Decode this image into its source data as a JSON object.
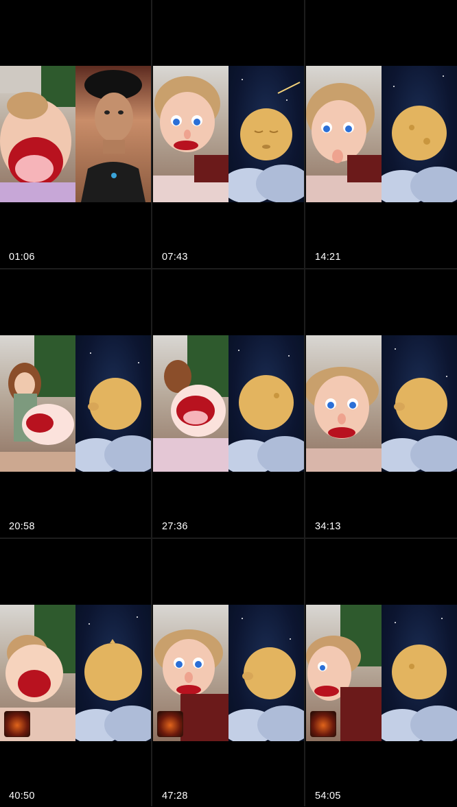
{
  "grid": {
    "cells": [
      {
        "time": "01:06",
        "left": "puppet-mouth-open",
        "right": "person-selfie"
      },
      {
        "time": "07:43",
        "left": "puppet-blue-eyes",
        "right": "moon-face-shooting-star"
      },
      {
        "time": "14:21",
        "left": "puppet-blue-eyes",
        "right": "moon"
      },
      {
        "time": "20:58",
        "left": "doll-and-puppet-hand",
        "right": "moon-face-side"
      },
      {
        "time": "27:36",
        "left": "puppet-mouth-open",
        "right": "moon"
      },
      {
        "time": "34:13",
        "left": "puppet-blue-eyes",
        "right": "moon-face-side"
      },
      {
        "time": "40:50",
        "left": "puppet-mouth-open",
        "right": "moon",
        "badge": true
      },
      {
        "time": "47:28",
        "left": "puppet-blue-eyes",
        "right": "moon-face-side",
        "badge": true
      },
      {
        "time": "54:05",
        "left": "puppet-mouth-open",
        "right": "moon",
        "badge": true
      }
    ]
  },
  "colors": {
    "background": "#000000",
    "moon": "#e3b45f",
    "sky": "#0c1530",
    "puppet_mouth": "#c8102e"
  }
}
